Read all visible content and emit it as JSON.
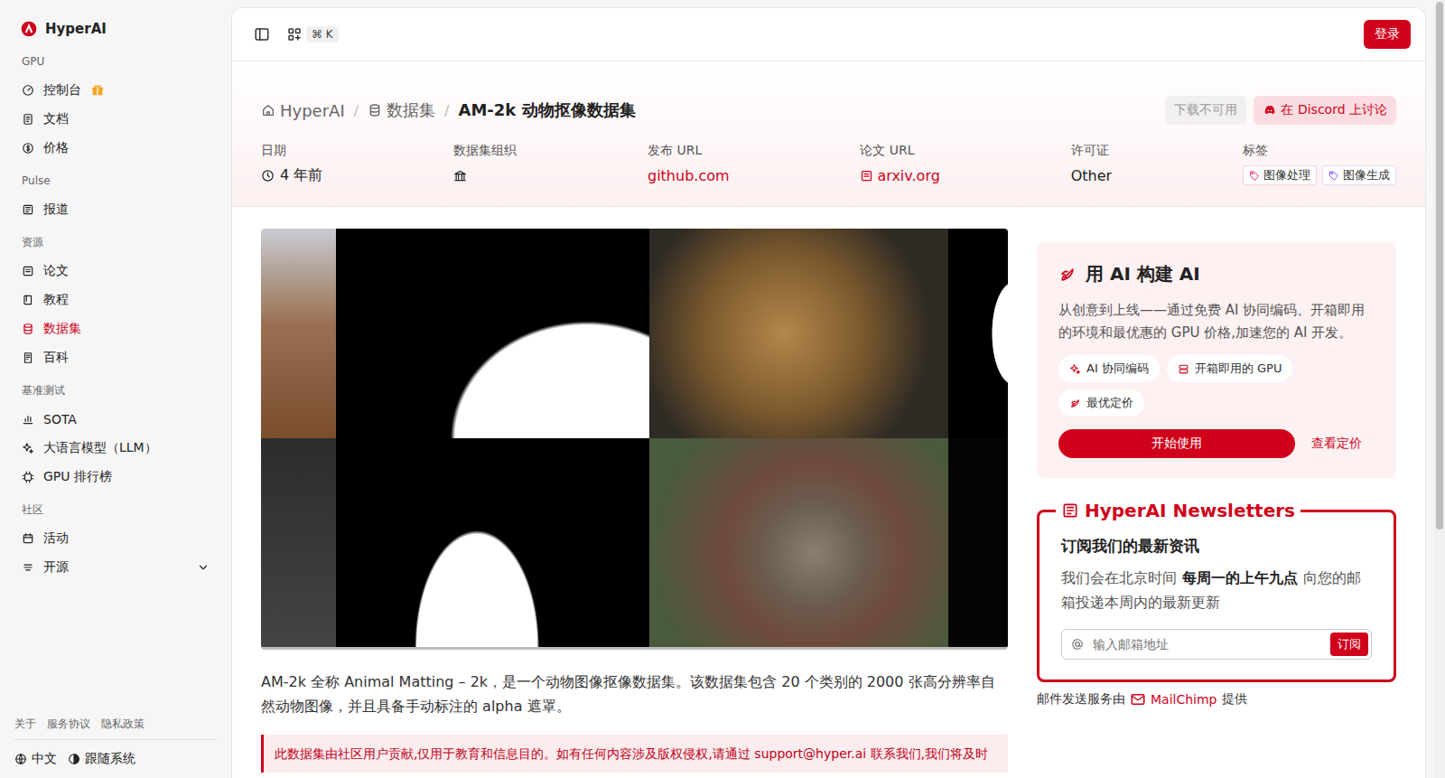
{
  "sidebar": {
    "logo": "HyperAI",
    "groups": [
      {
        "label": "GPU",
        "items": [
          {
            "label": "控制台",
            "selected": false,
            "promo": true
          },
          {
            "label": "文档",
            "selected": false,
            "promo": false
          },
          {
            "label": "价格",
            "selected": false,
            "promo": false
          }
        ]
      },
      {
        "label": "Pulse",
        "items": [
          {
            "label": "报道",
            "selected": false,
            "promo": false
          }
        ]
      },
      {
        "label": "资源",
        "items": [
          {
            "label": "论文",
            "selected": false,
            "promo": false
          },
          {
            "label": "教程",
            "selected": false,
            "promo": false
          },
          {
            "label": "数据集",
            "selected": true,
            "promo": false
          },
          {
            "label": "百科",
            "selected": false,
            "promo": false
          }
        ]
      },
      {
        "label": "基准测试",
        "items": [
          {
            "label": "SOTA",
            "selected": false,
            "promo": false
          },
          {
            "label": "大语言模型（LLM）",
            "selected": false,
            "promo": false
          },
          {
            "label": "GPU 排行榜",
            "selected": false,
            "promo": false
          }
        ]
      },
      {
        "label": "社区",
        "items": [
          {
            "label": "活动",
            "selected": false,
            "promo": false
          },
          {
            "label": "开源",
            "selected": false,
            "promo": false,
            "expanded": false
          }
        ]
      }
    ],
    "footer": {
      "links": [
        "关于",
        "服务协议",
        "隐私政策"
      ],
      "language": "中文",
      "theme": "跟随系统"
    }
  },
  "topbar": {
    "shortcut": "⌘ K",
    "login": "登录"
  },
  "breadcrumb": {
    "separator": "/",
    "items": [
      {
        "label": "HyperAI",
        "current": false
      },
      {
        "label": "数据集",
        "current": false
      },
      {
        "label": "AM-2k 动物抠像数据集",
        "current": true
      }
    ]
  },
  "actions": [
    {
      "label": "下载不可用",
      "disabled": true
    },
    {
      "label": "在 Discord 上讨论",
      "disabled": false
    }
  ],
  "meta": [
    {
      "label": "日期",
      "kind": "time",
      "value": "4 年前"
    },
    {
      "label": "数据集组织",
      "kind": "org"
    },
    {
      "label": "发布 URL",
      "kind": "link",
      "value": "github.com"
    },
    {
      "label": "论文 URL",
      "kind": "paper",
      "value": "arxiv.org"
    },
    {
      "label": "许可证",
      "kind": "text",
      "value": "Other"
    },
    {
      "label": "标签",
      "kind": "tags",
      "tags": [
        {
          "label": "图像处理",
          "color": "#e0245e"
        },
        {
          "label": "图像生成",
          "color": "#7c4dff"
        }
      ]
    }
  ],
  "description": "AM-2k 全称 Animal Matting – 2k，是一个动物图像抠像数据集。该数据集包含 20 个类别的 2000 张高分辨率自然动物图像，并且具备手动标注的 alpha 遮罩。",
  "notice": "此数据集由社区用户贡献,仅用于教育和信息目的。如有任何内容涉及版权侵权,请通过 support@hyper.ai 联系我们,我们将及时",
  "promo": {
    "title": "用 AI 构建 AI",
    "text": "从创意到上线——通过免费 AI 协同编码、开箱即用的环境和最优惠的 GPU 价格,加速您的 AI 开发。",
    "chips": [
      "AI 协同编码",
      "开箱即用的 GPU",
      "最优定价"
    ],
    "button": "开始使用",
    "link": "查看定价"
  },
  "newsletter": {
    "title": "HyperAI Newsletters",
    "heading": "订阅我们的最新资讯",
    "text_before": "我们会在北京时间",
    "text_bold": "每周一的上午九点",
    "text_after": "向您的邮箱投递本周内的最新更新",
    "placeholder": "输入邮箱地址",
    "button": "订阅",
    "credit_before": "邮件发送服务由",
    "credit_link": "MailChimp",
    "credit_after": "提供"
  },
  "scrollbar": {
    "level": 0.68
  }
}
